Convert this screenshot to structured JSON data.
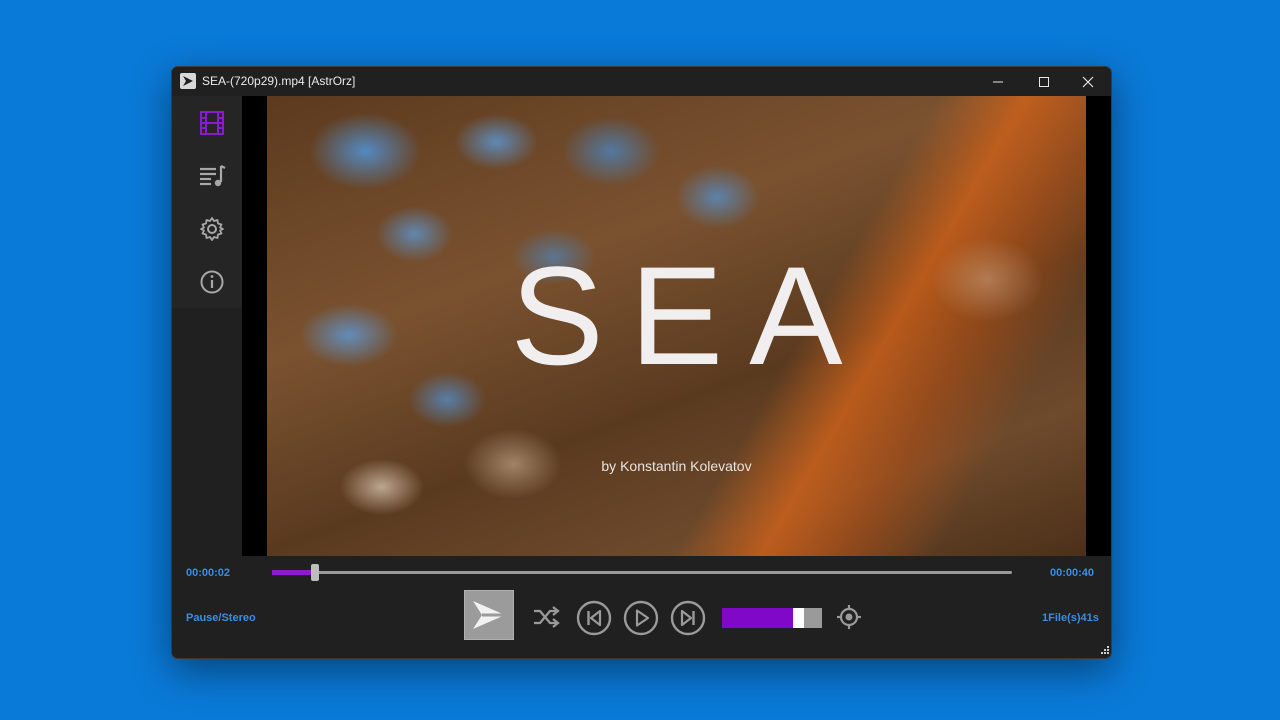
{
  "window": {
    "title": "SEA-(720p29).mp4 [AstrOrz]",
    "controls": [
      "minimize-icon",
      "maximize-icon",
      "close-icon"
    ]
  },
  "sidebar": {
    "items": [
      {
        "name": "video",
        "icon": "film-icon",
        "active": true
      },
      {
        "name": "playlist",
        "icon": "playlist-icon",
        "active": false
      },
      {
        "name": "settings",
        "icon": "gear-icon",
        "active": false
      },
      {
        "name": "about",
        "icon": "info-icon",
        "active": false
      }
    ]
  },
  "video": {
    "title": "SEA",
    "subtitle": "by Konstantin Kolevatov"
  },
  "playback": {
    "current_time": "00:00:02",
    "total_time": "00:00:40",
    "progress": 0.058
  },
  "status": {
    "left": "Pause/Stereo",
    "right": "1File(s)41s"
  },
  "controls": {
    "volume": 0.76,
    "icons": [
      "app-logo-icon",
      "shuffle-icon",
      "previous-icon",
      "play-icon",
      "next-icon",
      "target-icon"
    ]
  },
  "colors": {
    "accent": "#8a1bd1",
    "status_text": "#3b8ee0",
    "desktop": "#0a7ad8",
    "window_bg": "#202020"
  }
}
